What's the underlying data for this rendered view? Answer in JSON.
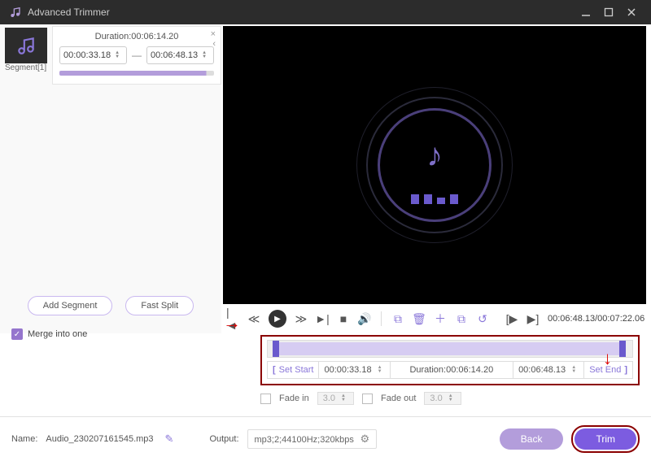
{
  "window": {
    "title": "Advanced Trimmer"
  },
  "segment": {
    "caption": "Segment[1]",
    "duration_label": "Duration:00:06:14.20",
    "start": "00:00:33.18",
    "end": "00:06:48.13"
  },
  "side_buttons": {
    "add_segment": "Add Segment",
    "fast_split": "Fast Split"
  },
  "merge": {
    "label": "Merge into one",
    "checked": true
  },
  "playback": {
    "time": "00:06:48.13/00:07:22.06"
  },
  "trim": {
    "set_start_label": "Set Start",
    "start": "00:00:33.18",
    "duration_label": "Duration:00:06:14.20",
    "end": "00:06:48.13",
    "set_end_label": "Set End"
  },
  "fade": {
    "in_label": "Fade in",
    "in_value": "3.0",
    "out_label": "Fade out",
    "out_value": "3.0"
  },
  "footer": {
    "name_label": "Name:",
    "name_value": "Audio_230207161545.mp3",
    "output_label": "Output:",
    "output_value": "mp3;2;44100Hz;320kbps",
    "back": "Back",
    "trim": "Trim"
  }
}
